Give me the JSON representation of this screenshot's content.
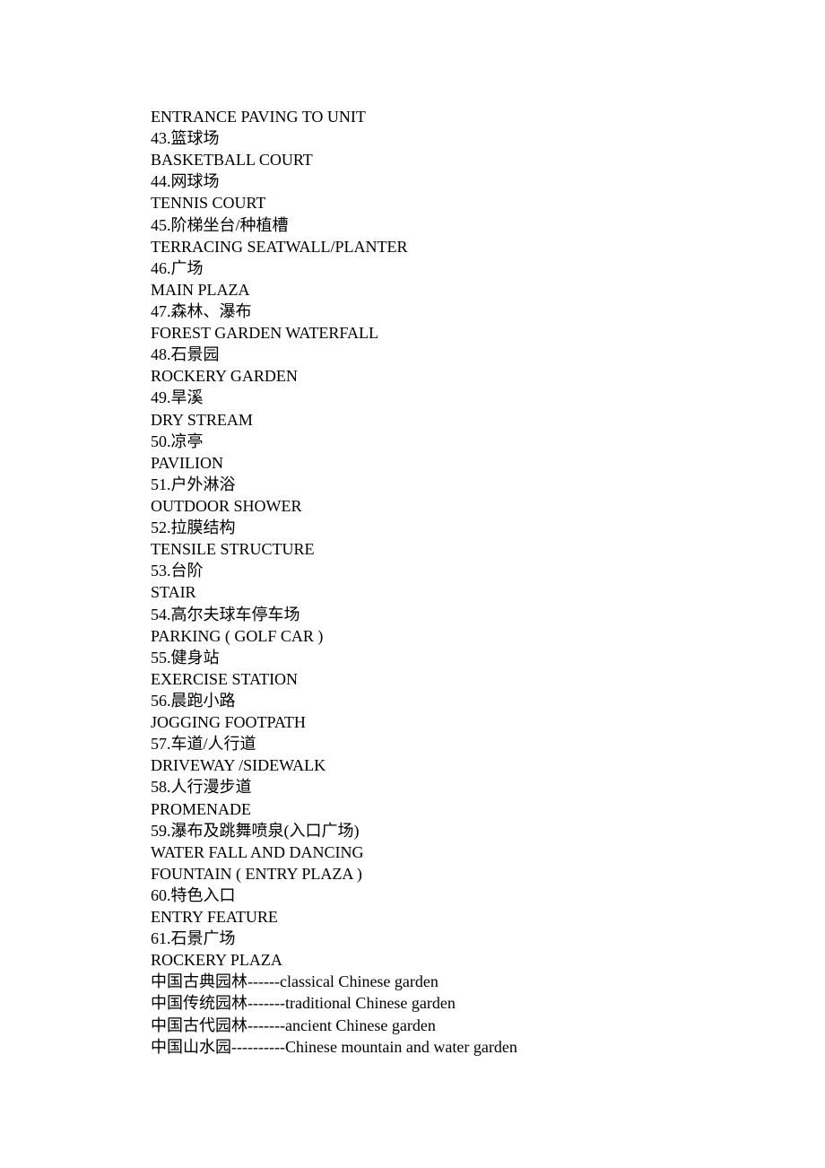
{
  "lines": [
    "ENTRANCE PAVING TO UNIT",
    "43.篮球场",
    "BASKETBALL COURT",
    "44.网球场",
    "TENNIS COURT",
    "45.阶梯坐台/种植槽",
    "TERRACING SEATWALL/PLANTER",
    "46.广场",
    "MAIN PLAZA",
    "47.森林、瀑布",
    "FOREST GARDEN WATERFALL",
    "48.石景园",
    "ROCKERY GARDEN",
    "49.旱溪",
    "DRY STREAM",
    "50.凉亭",
    "PAVILION",
    "51.户外淋浴",
    "OUTDOOR SHOWER",
    "52.拉膜结构",
    "TENSILE STRUCTURE",
    "53.台阶",
    "STAIR",
    "54.高尔夫球车停车场",
    "PARKING ( GOLF CAR )",
    "55.健身站",
    "EXERCISE STATION",
    "56.晨跑小路",
    "JOGGING FOOTPATH",
    "57.车道/人行道",
    "DRIVEWAY /SIDEWALK",
    "58.人行漫步道",
    "PROMENADE",
    "59.瀑布及跳舞喷泉(入口广场)",
    "WATER FALL AND DANCING",
    "FOUNTAIN ( ENTRY PLAZA )",
    "60.特色入口",
    "ENTRY FEATURE",
    "61.石景广场",
    "ROCKERY PLAZA",
    "中国古典园林------classical Chinese garden",
    "中国传统园林-------traditional Chinese garden",
    "中国古代园林-------ancient Chinese garden",
    "中国山水园----------Chinese mountain and water garden"
  ]
}
